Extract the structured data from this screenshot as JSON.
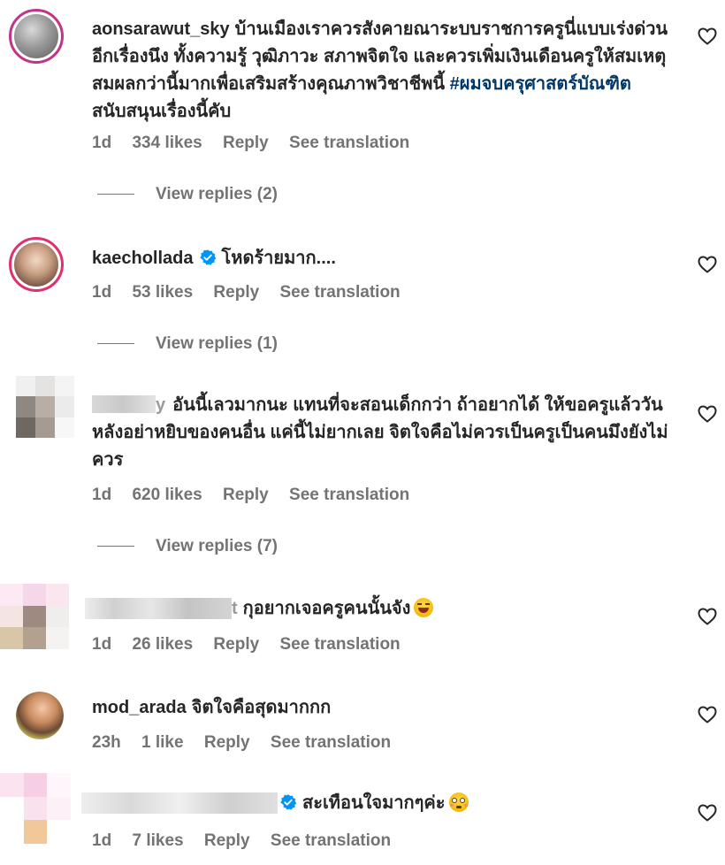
{
  "comments": [
    {
      "username": "aonsarawut_sky",
      "text": "บ้านเมืองเราควรสังคายณาระบบราชการครูนี่แบบเร่งด่วนอีกเรื่องนึง ทั้งความรู้ วุฒิภาวะ สภาพจิตใจ และควรเพิ่มเงินเดือนครูให้สมเหตุสมผลกว่านี้มากเพื่อเสริมสร้างคุณภาพวิชาชีพนี้",
      "hashtag": "#ผมจบครุศาสตร์บัณฑิต",
      "text_after": "สนับสนุนเรื่องนี้คับ",
      "time": "1d",
      "likes": "334 likes",
      "reply": "Reply",
      "translate": "See translation",
      "view_replies": "View replies (2)"
    },
    {
      "username": "kaechollada",
      "text": "โหดร้ายมาก....",
      "time": "1d",
      "likes": "53 likes",
      "reply": "Reply",
      "translate": "See translation",
      "view_replies": "View replies (1)"
    },
    {
      "username_partial": "y",
      "text": "อันนี้เลวมากนะ แทนที่จะสอนเด็กกว่า ถ้าอยากได้ ให้ขอครูแล้ววันหลังอย่าหยิบของคนอื่น แค่นี้ไม่ยากเลย จิตใจคือไม่ควรเป็นครูเป็นคนมึงยังไม่ควร",
      "time": "1d",
      "likes": "620 likes",
      "reply": "Reply",
      "translate": "See translation",
      "view_replies": "View replies (7)"
    },
    {
      "username_partial": "t",
      "text": "กุอยากเจอครูคนนั้นจัง",
      "time": "1d",
      "likes": "26 likes",
      "reply": "Reply",
      "translate": "See translation"
    },
    {
      "username": "mod_arada",
      "text": "จิตใจคือสุดมากกก",
      "time": "23h",
      "likes": "1 like",
      "reply": "Reply",
      "translate": "See translation"
    },
    {
      "text": "สะเทือนใจมากๆค่ะ",
      "time": "1d",
      "likes": "7 likes",
      "reply": "Reply",
      "translate": "See translation"
    }
  ],
  "colors": {
    "text": "#262626",
    "secondary": "#737373",
    "hashtag": "#00376b",
    "verified": "#0095f6",
    "story_ring": "#c13584"
  },
  "icons": [
    "heart-icon",
    "verified-badge-icon",
    "laughing-emoji-icon",
    "flushed-emoji-icon"
  ]
}
